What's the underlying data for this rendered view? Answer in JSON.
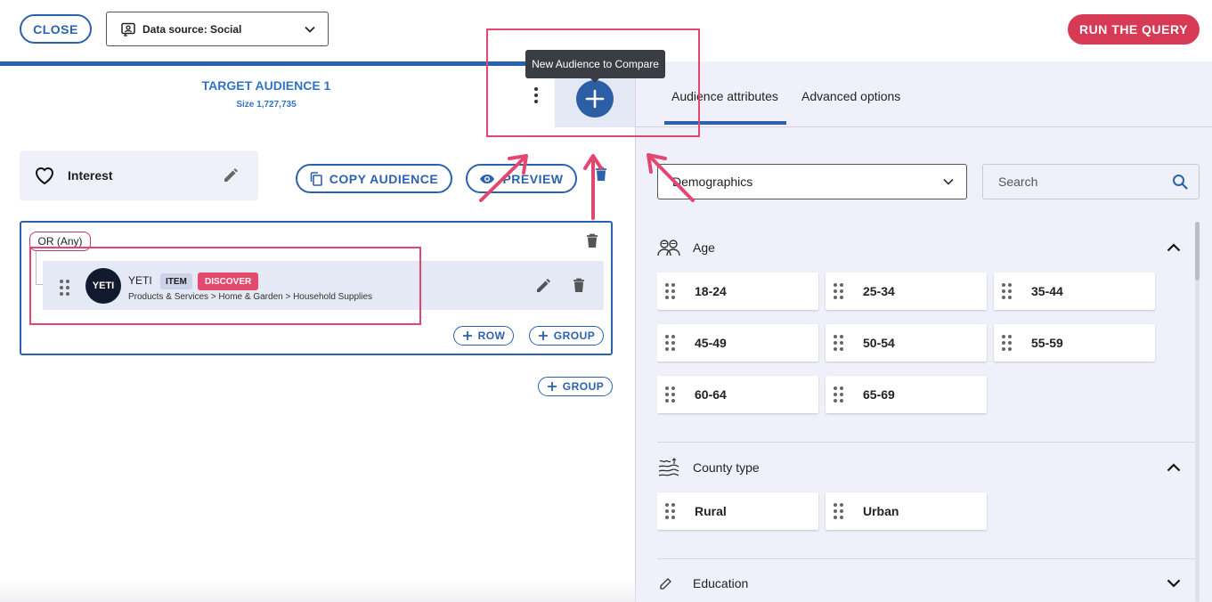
{
  "top_bar": {
    "close_label": "CLOSE",
    "data_source_label": "Data source: Social",
    "run_label": "RUN THE QUERY"
  },
  "audience": {
    "title": "TARGET AUDIENCE 1",
    "size": "Size 1,727,735",
    "tooltip": "New Audience to Compare",
    "interest_label": "Interest",
    "copy_label": "COPY AUDIENCE",
    "preview_label": "PREVIEW"
  },
  "group": {
    "operator_label": "OR (Any)",
    "item": {
      "logo_text": "YETI",
      "name": "YETI",
      "tag_type": "ITEM",
      "tag_action": "DISCOVER",
      "path": "Products & Services > Home & Garden > Household Supplies"
    },
    "add_row_label": "ROW",
    "add_group_label": "GROUP",
    "outer_group_label": "GROUP"
  },
  "right_panel": {
    "tabs": [
      "Audience attributes",
      "Advanced options"
    ],
    "category_select": "Demographics",
    "search_placeholder": "Search",
    "sections": [
      {
        "name": "Age",
        "icon": "people-icon",
        "options": [
          "18-24",
          "25-34",
          "35-44",
          "45-49",
          "50-54",
          "55-59",
          "60-64",
          "65-69"
        ]
      },
      {
        "name": "County type",
        "icon": "landscape-icon",
        "options": [
          "Rural",
          "Urban"
        ]
      },
      {
        "name": "Education",
        "icon": "education-icon",
        "options": []
      }
    ]
  },
  "colors": {
    "brand_blue": "#2c62ad",
    "run_red": "#d63a55",
    "highlight_pink": "#e3476f",
    "panel_bg": "#f0f0fa"
  }
}
